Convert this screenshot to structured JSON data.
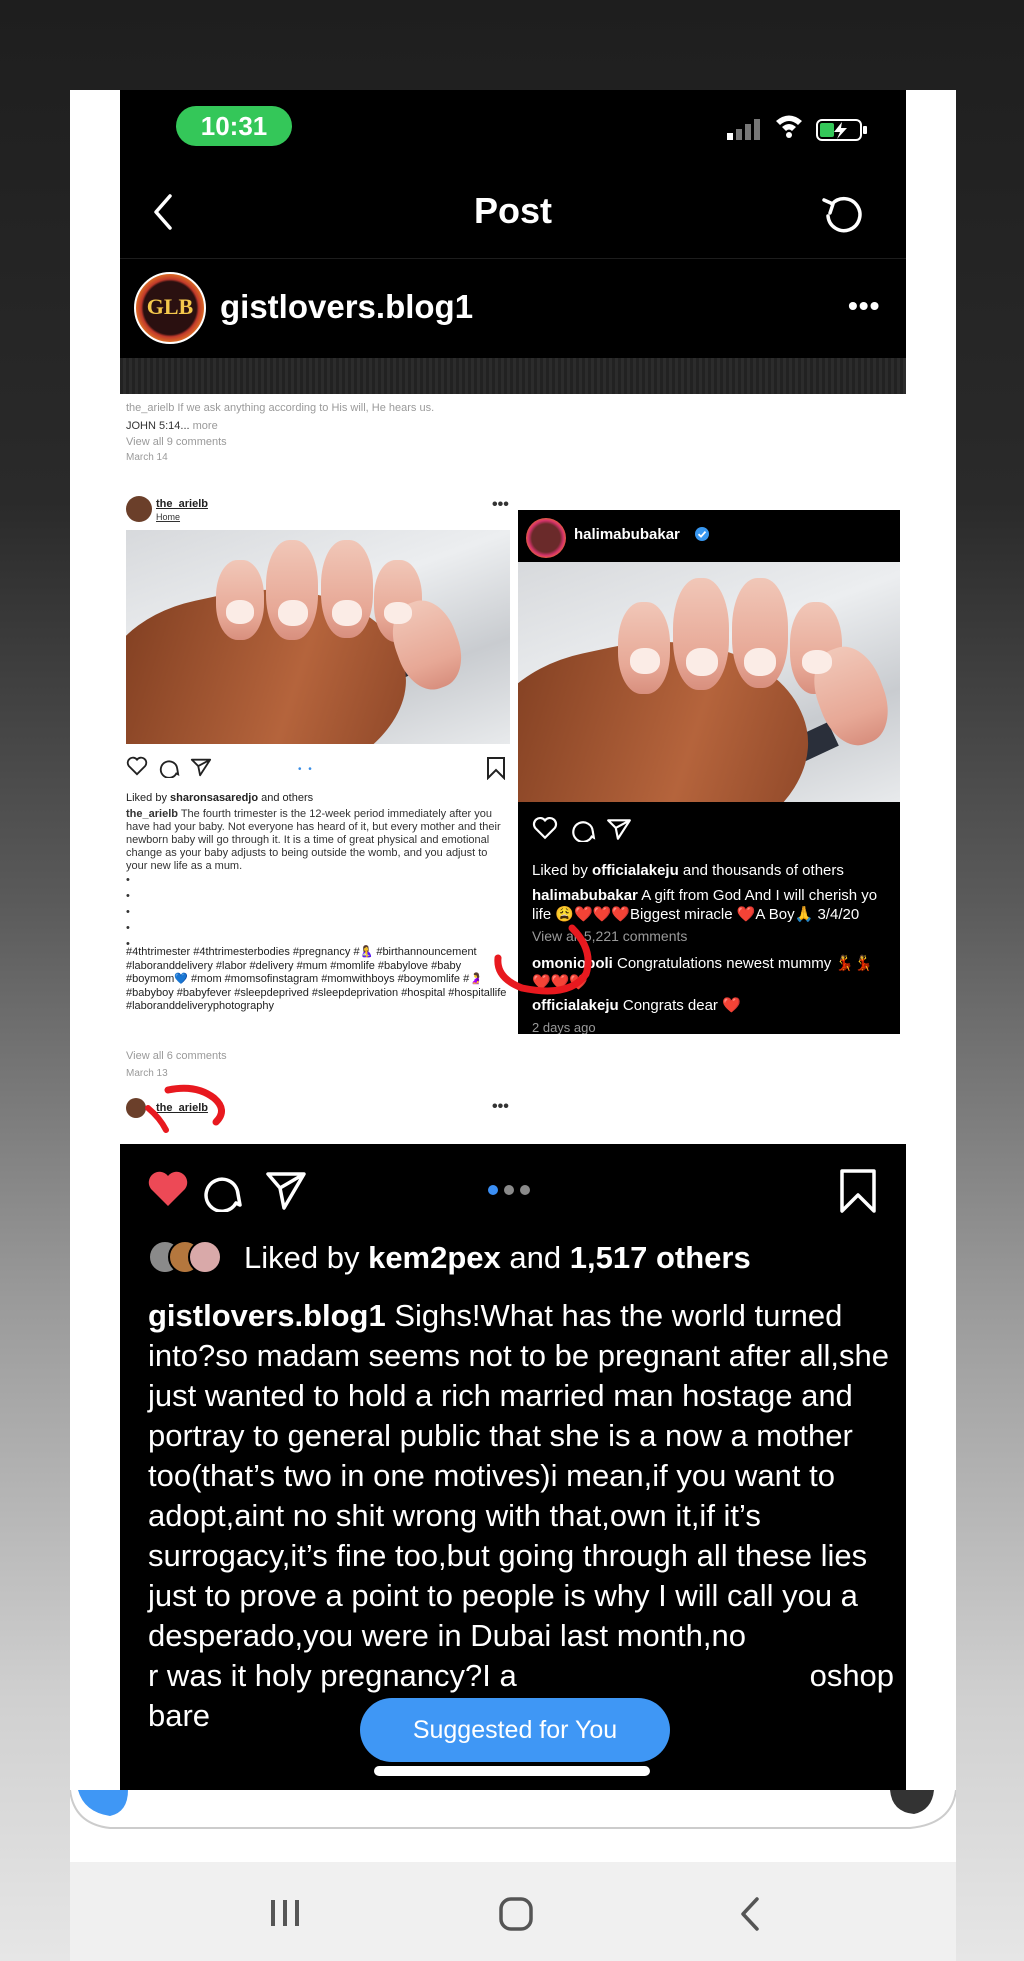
{
  "status_bar": {
    "time": "10:31"
  },
  "nav": {
    "title": "Post"
  },
  "profile": {
    "avatar_text": "GLB",
    "username": "gistlovers.blog1",
    "more": "•••"
  },
  "left_post": {
    "truncated_line": "the_arielb If we ask anything according to His will, He hears us.",
    "verse": "JOHN 5:14...",
    "more_label": "more",
    "view_all": "View all 9 comments",
    "date": "March 14",
    "username": "the_arielb",
    "location": "Home",
    "more": "•••",
    "dots_indicator": "• •",
    "liked_prefix": "Liked by ",
    "liked_user": "sharonsasaredjo",
    "liked_suffix": " and others",
    "caption_user": "the_arielb",
    "caption": " The fourth trimester is the 12-week period immediately after you have had your baby. Not everyone has heard of it, but every mother and their newborn baby will go through it. It is a time of great physical and emotional change as your baby adjusts to being outside the womb, and you adjust to your new life as a mum.",
    "dot_lines": "•\n•\n•\n•\n•",
    "hashtags": "#4thtrimester #4thtrimesterbodies #pregnancy #🤱 #birthannouncement #laboranddelivery #labor #delivery #mum #momlife #babylove #baby #boymom💙 #mom #momsofinstagram #momwithboys #boymomlife #🤰 #babyboy #babyfever #sleepdeprived #sleepdeprivation #hospital #hospitallife #laboranddeliveryphotography",
    "view_all_2": "View all 6 comments",
    "date_2": "March 13",
    "username_2": "the_arielb",
    "more_2": "•••"
  },
  "right_post": {
    "username": "halimabubakar",
    "liked_prefix": "Liked by ",
    "liked_user": "officialakeju",
    "liked_suffix": " and thousands of others",
    "caption_user": "halimabubakar",
    "caption_line1": " A gift from God And I will cherish yo",
    "caption_line2": "life 😩❤️❤️❤️Biggest miracle ❤️A Boy🙏 3/4/20",
    "view_all": "View all 5,221 comments",
    "comment1_user": "omonioboli",
    "comment1_text": " Congratulations newest mummy 💃💃",
    "comment1_line2": "❤️❤️❤️",
    "comment2_user": "officialakeju",
    "comment2_text": " Congrats dear ❤️",
    "time": "2 days ago"
  },
  "main_post": {
    "liked_prefix": "Liked by ",
    "liked_user": "kem2pex",
    "liked_mid": " and ",
    "liked_count": "1,517 others",
    "caption_user": "gistlovers.blog1",
    "caption": " Sighs!What has the world turned into?so madam seems not to be pregnant after all,she just wanted to hold a rich married man hostage and portray to general public that she is a now a mother too(that’s two in one motives)i mean,if you want to adopt,aint no shit wrong with that,own it,if it’s surrogacy,it’s fine too,but going through all these lies just to prove a point to people is why I will call you a desperado,you were in Dubai last month,no                          r was it holy pregnancy?I a                                  oshop bare"
  },
  "suggested": {
    "label": "Suggested for You"
  },
  "colors": {
    "accent_blue": "#3f97f5",
    "like_red": "#ed4956",
    "status_green": "#34c759",
    "annotation_red": "#e8191f"
  }
}
